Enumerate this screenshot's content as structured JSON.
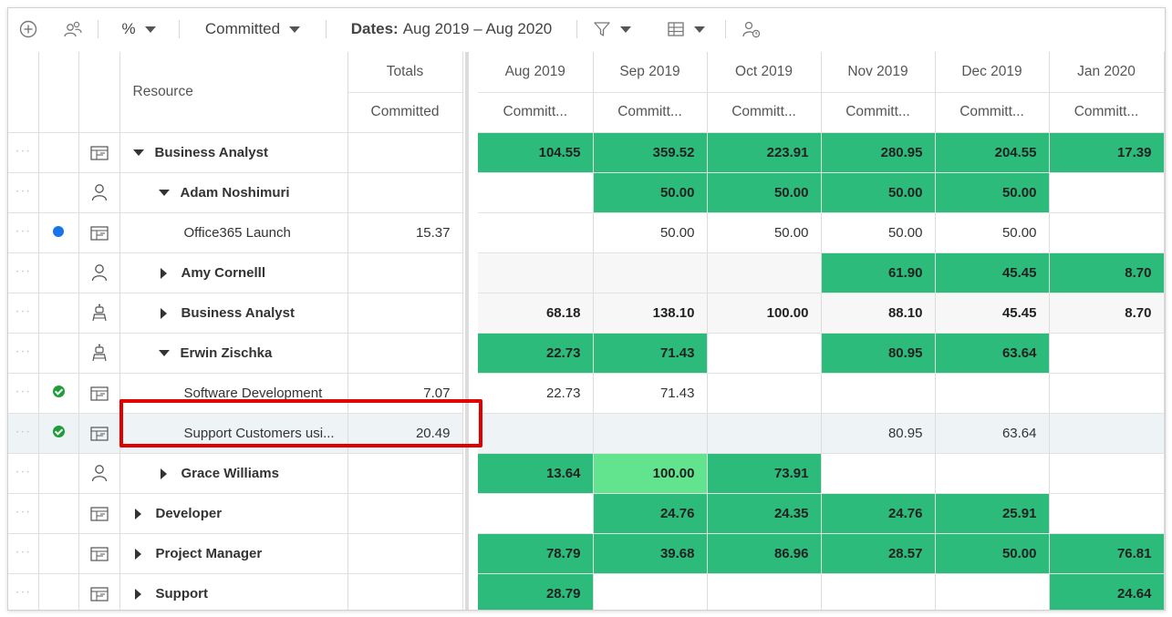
{
  "toolbar": {
    "percent_label": "%",
    "committed_label": "Committed",
    "dates_prefix": "Dates:",
    "dates_range": "Aug 2019 – Aug 2020"
  },
  "columns": {
    "resource": "Resource",
    "totals": "Totals",
    "totals_sub": "Committed",
    "months": [
      "Aug 2019",
      "Sep 2019",
      "Oct 2019",
      "Nov 2019",
      "Dec 2019",
      "Jan 2020"
    ],
    "month_sub": "Committ..."
  },
  "rows": [
    {
      "name": "Business Analyst",
      "icon": "role-icon",
      "status": "",
      "total": "",
      "values": [
        "104.55",
        "359.52",
        "223.91",
        "280.95",
        "204.55",
        "17.39"
      ],
      "fill": [
        "g",
        "g",
        "g",
        "g",
        "g",
        "g"
      ]
    },
    {
      "name": "Adam Noshimuri",
      "icon": "person-icon",
      "status": "",
      "total": "",
      "values": [
        "",
        "50.00",
        "50.00",
        "50.00",
        "50.00",
        ""
      ],
      "fill": [
        "",
        "g",
        "g",
        "g",
        "g",
        ""
      ]
    },
    {
      "name": "Office365 Launch",
      "icon": "role-icon",
      "status": "blue",
      "total": "15.37",
      "values": [
        "",
        "50.00",
        "50.00",
        "50.00",
        "50.00",
        ""
      ],
      "fill": [
        "",
        "",
        "",
        "",
        "",
        ""
      ]
    },
    {
      "name": "Amy Cornelll",
      "icon": "person-icon",
      "status": "",
      "total": "",
      "values": [
        "",
        "",
        "",
        "61.90",
        "45.45",
        "8.70"
      ],
      "fill": [
        "",
        "",
        "",
        "g",
        "g",
        "g"
      ]
    },
    {
      "name": "Business Analyst",
      "icon": "robot-icon",
      "status": "",
      "total": "",
      "values": [
        "68.18",
        "138.10",
        "100.00",
        "88.10",
        "45.45",
        "8.70"
      ],
      "fill": [
        "",
        "",
        "",
        "",
        "",
        ""
      ]
    },
    {
      "name": "Erwin Zischka",
      "icon": "robot-icon",
      "status": "",
      "total": "",
      "values": [
        "22.73",
        "71.43",
        "",
        "80.95",
        "63.64",
        ""
      ],
      "fill": [
        "g",
        "g",
        "",
        "g",
        "g",
        ""
      ]
    },
    {
      "name": "Software Development",
      "icon": "role-icon",
      "status": "green",
      "total": "7.07",
      "values": [
        "22.73",
        "71.43",
        "",
        "",
        "",
        ""
      ],
      "fill": [
        "",
        "",
        "",
        "",
        "",
        ""
      ]
    },
    {
      "name": "Support Customers usi...",
      "icon": "role-icon",
      "status": "green",
      "total": "20.49",
      "values": [
        "",
        "",
        "",
        "80.95",
        "63.64",
        ""
      ],
      "fill": [
        "",
        "",
        "",
        "",
        "",
        ""
      ]
    },
    {
      "name": "Grace Williams",
      "icon": "person-icon",
      "status": "",
      "total": "",
      "values": [
        "13.64",
        "100.00",
        "73.91",
        "",
        "",
        ""
      ],
      "fill": [
        "g",
        "lg",
        "g",
        "",
        "",
        ""
      ]
    },
    {
      "name": "Developer",
      "icon": "role-icon",
      "status": "",
      "total": "",
      "values": [
        "",
        "24.76",
        "24.35",
        "24.76",
        "25.91",
        ""
      ],
      "fill": [
        "",
        "g",
        "g",
        "g",
        "g",
        ""
      ]
    },
    {
      "name": "Project Manager",
      "icon": "role-icon",
      "status": "",
      "total": "",
      "values": [
        "78.79",
        "39.68",
        "86.96",
        "28.57",
        "50.00",
        "76.81"
      ],
      "fill": [
        "g",
        "g",
        "g",
        "g",
        "g",
        "g"
      ]
    },
    {
      "name": "Support",
      "icon": "role-icon",
      "status": "",
      "total": "",
      "values": [
        "28.79",
        "",
        "",
        "",
        "",
        "24.64"
      ],
      "fill": [
        "g",
        "",
        "",
        "",
        "",
        "g"
      ]
    }
  ],
  "colors": {
    "green": "#2cbb7a",
    "light_green": "#62e38d",
    "highlight": "#e00000"
  }
}
